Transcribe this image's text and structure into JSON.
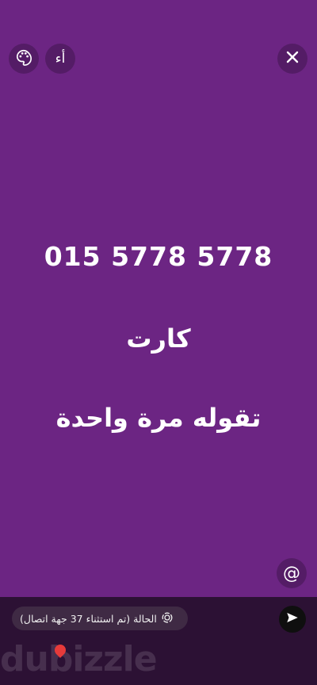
{
  "toolbar": {
    "palette_icon": "palette-icon",
    "font_label": "أء",
    "close_icon": "close-icon"
  },
  "story": {
    "background_color": "#6c2583",
    "line1": "015 5778 5778",
    "line2": "كارت",
    "line3": "تقوله مرة واحدة"
  },
  "mention": {
    "label": "@"
  },
  "status": {
    "icon": "status-ring-icon",
    "text": "الحالة (تم استثناء 37 جهة اتصال)"
  },
  "send": {
    "icon": "send-icon"
  },
  "watermark": {
    "text": "dubizzle"
  }
}
